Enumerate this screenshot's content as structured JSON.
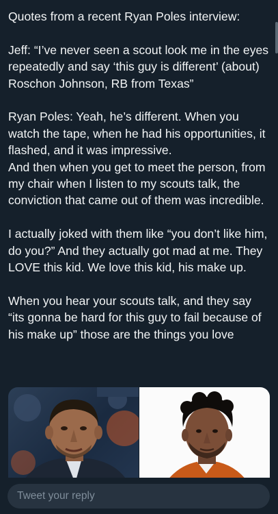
{
  "tweet": {
    "paragraphs": [
      "Quotes from a recent Ryan Poles interview:",
      "Jeff: “I’ve never seen a scout look me in the eyes repeatedly and say ‘this guy is different’ (about) Roschon Johnson, RB from Texas”",
      "Ryan Poles: Yeah, he’s different. When you watch the tape, when he had his opportunities, it flashed, and it was impressive.\nAnd then when you get to meet the person, from my chair when I listen to my scouts talk, the conviction that came out of them was incredible.",
      "I actually joked with them like “you don’t like him, do you?” And they actually got mad at me. They LOVE this kid. We love this kid, his make up.",
      "When you hear your scouts talk, and they say “its gonna be hard for this guy to fail because of his make up” those are the things you love"
    ]
  },
  "reply": {
    "placeholder": "Tweet your reply"
  },
  "colors": {
    "background": "#15202b",
    "text": "#f2f4f5",
    "reply_field": "#273340",
    "placeholder": "#7f8d9a"
  }
}
